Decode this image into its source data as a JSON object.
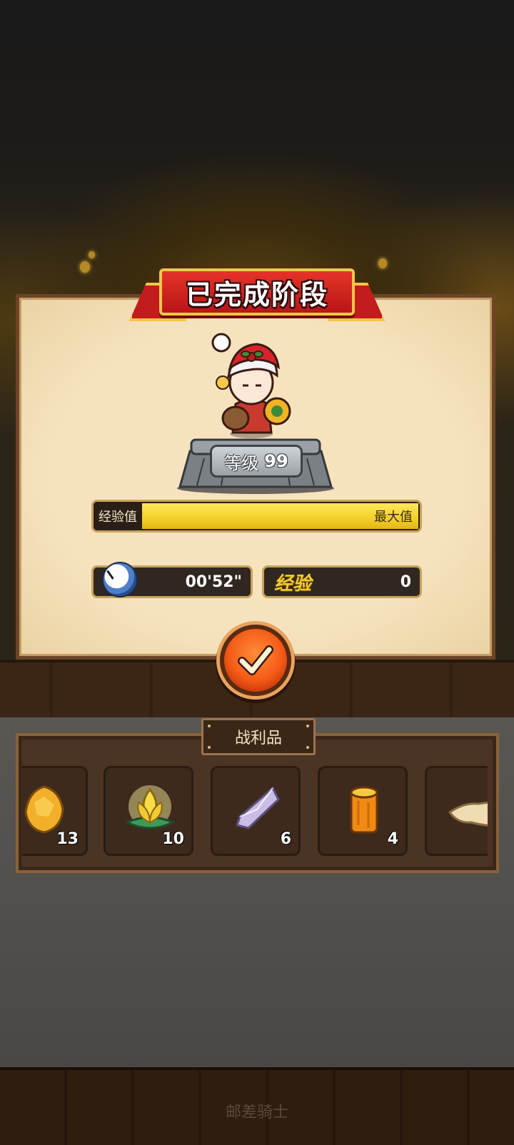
{
  "stage_result": {
    "title": "已完成阶段",
    "level_label": "等级",
    "level_value": "99",
    "xp_label": "经验值",
    "xp_status": "最大值",
    "xp_fill_fraction": 1.0,
    "time_value": "00'52\"",
    "exp_label": "经验",
    "exp_value": "0",
    "confirm_icon": "checkmark-icon"
  },
  "loot": {
    "title": "战利品",
    "items": [
      {
        "icon": "gold-ore-icon",
        "count": "13"
      },
      {
        "icon": "lotus-icon",
        "count": "10"
      },
      {
        "icon": "crystal-icon",
        "count": "6"
      },
      {
        "icon": "wood-log-icon",
        "count": "4"
      },
      {
        "icon": "cloth-icon",
        "count": ""
      }
    ]
  },
  "footer": {
    "text": "邮差骑士"
  },
  "colors": {
    "ribbon_red": "#c21c1c",
    "xp_yellow": "#f3cf2a",
    "confirm_orange": "#f45a16",
    "panel_parchment": "#f6e3be"
  }
}
